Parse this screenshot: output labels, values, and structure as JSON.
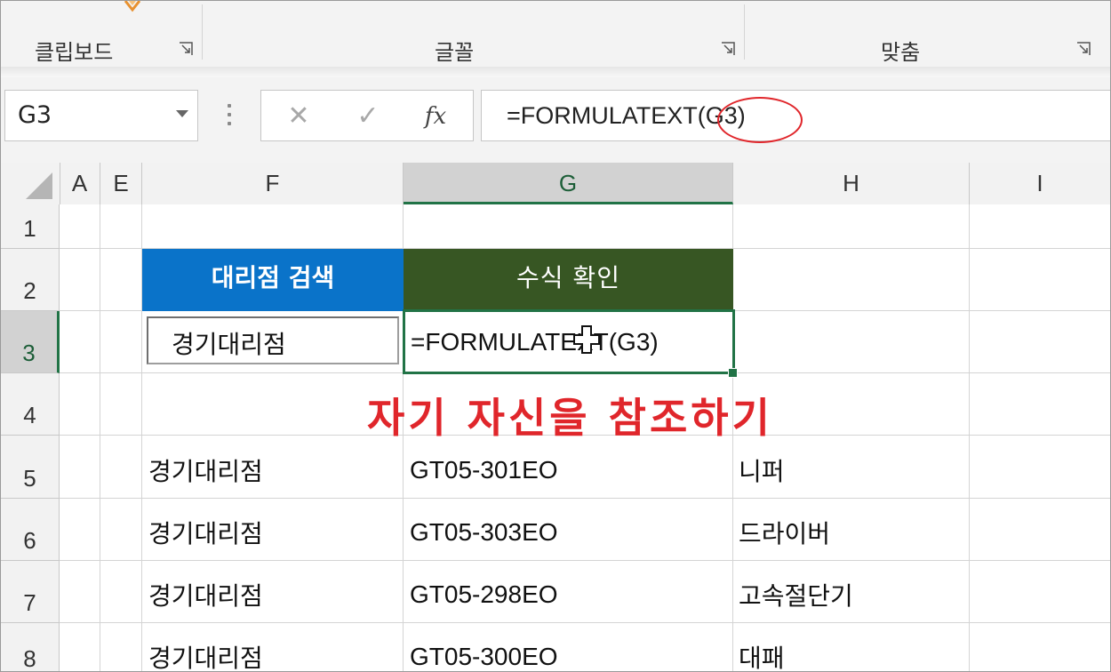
{
  "ribbon": {
    "groups": [
      {
        "label": "클립보드"
      },
      {
        "label": "글꼴"
      },
      {
        "label": "맞춤"
      }
    ]
  },
  "formula_bar": {
    "name_box": "G3",
    "cancel_symbol": "✕",
    "enter_symbol": "✓",
    "fx_label": "fx",
    "formula": "=FORMULATEXT(G3)"
  },
  "columns": [
    "A",
    "E",
    "F",
    "G",
    "H",
    "I"
  ],
  "selected_column": "G",
  "rows": [
    "1",
    "2",
    "3",
    "4",
    "5",
    "6",
    "7",
    "8"
  ],
  "selected_row": "3",
  "sheet": {
    "f2_header": "대리점 검색",
    "g2_header": "수식 확인",
    "f3_input": "경기대리점",
    "g3_result": "=FORMULATEXT(G3)",
    "annotation": "자기 자신을 참조하기",
    "data_rows": [
      {
        "dealer": "경기대리점",
        "code": "GT05-301EO",
        "item": "니퍼"
      },
      {
        "dealer": "경기대리점",
        "code": "GT05-303EO",
        "item": "드라이버"
      },
      {
        "dealer": "경기대리점",
        "code": "GT05-298EO",
        "item": "고속절단기"
      },
      {
        "dealer": "경기대리점",
        "code": "GT05-300EO",
        "item": "대패"
      }
    ]
  },
  "colors": {
    "blue_header": "#0a73c9",
    "green_header": "#375623",
    "selection_green": "#217346",
    "annotation_red": "#e0262b"
  }
}
